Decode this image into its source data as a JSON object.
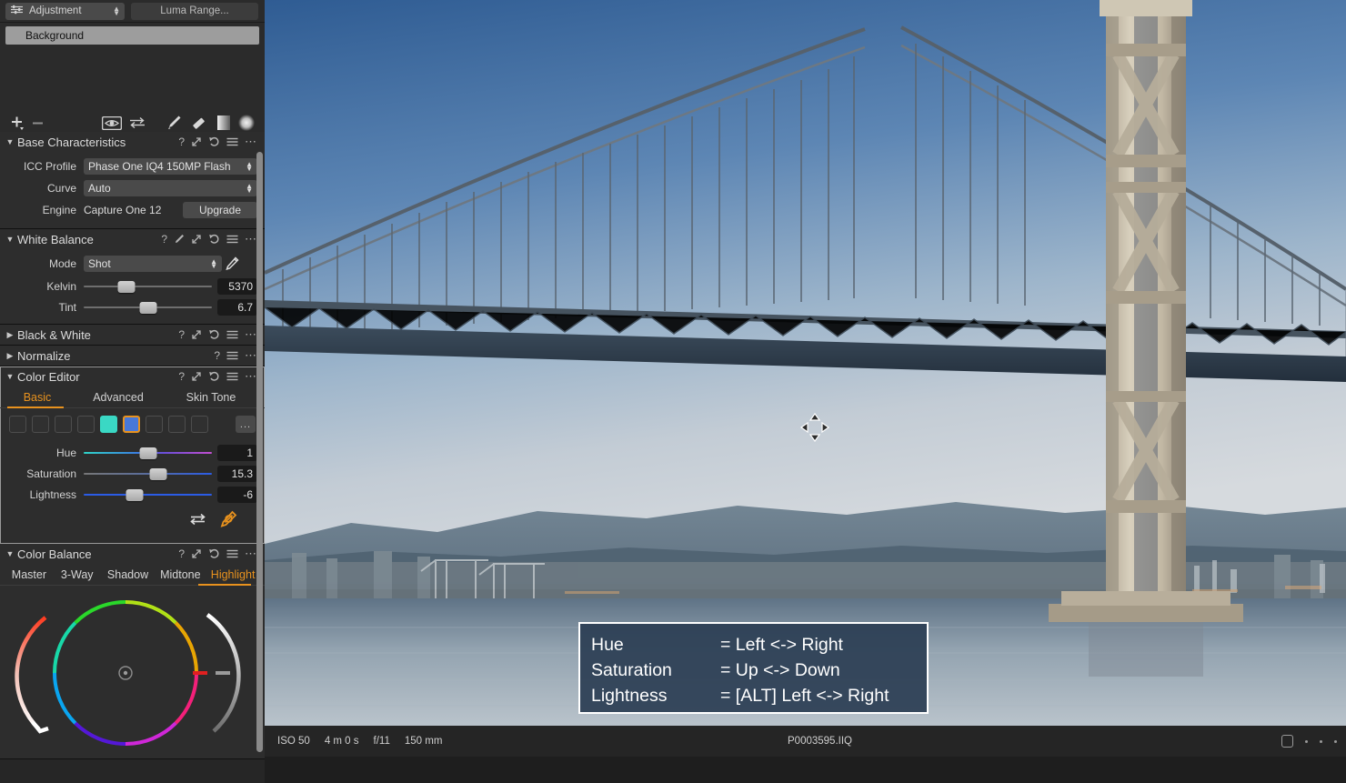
{
  "layer_bar": {
    "adjustment_label": "Adjustment",
    "adjustment_icon": "sliders-icon",
    "luma_range_label": "Luma Range...",
    "layers": [
      "Background"
    ],
    "tools": [
      "add-layer-icon",
      "remove-layer-icon",
      "eye-icon",
      "swap-icon",
      "brush-icon",
      "eraser-icon",
      "gradient-mask-icon",
      "radial-mask-icon"
    ]
  },
  "tools": {
    "base_characteristics": {
      "title": "Base Characteristics",
      "expanded": true,
      "icc_profile_label": "ICC Profile",
      "icc_profile_value": "Phase One IQ4 150MP Flash",
      "curve_label": "Curve",
      "curve_value": "Auto",
      "engine_label": "Engine",
      "engine_value": "Capture One 12",
      "upgrade_label": "Upgrade"
    },
    "white_balance": {
      "title": "White Balance",
      "expanded": true,
      "mode_label": "Mode",
      "mode_value": "Shot",
      "kelvin_label": "Kelvin",
      "kelvin_value": "5370",
      "kelvin_pct": 33,
      "tint_label": "Tint",
      "tint_value": "6.7",
      "tint_pct": 50
    },
    "black_and_white": {
      "title": "Black & White",
      "expanded": false
    },
    "normalize": {
      "title": "Normalize",
      "expanded": false
    },
    "color_editor": {
      "title": "Color Editor",
      "expanded": true,
      "tabs": [
        {
          "label": "Basic",
          "active": true
        },
        {
          "label": "Advanced",
          "active": false
        },
        {
          "label": "Skin Tone",
          "active": false
        }
      ],
      "swatches": [
        {
          "color": null,
          "selected": false
        },
        {
          "color": null,
          "selected": false
        },
        {
          "color": null,
          "selected": false
        },
        {
          "color": null,
          "selected": false
        },
        {
          "color": "#3ad8c4",
          "selected": false
        },
        {
          "color": "#4878d8",
          "selected": true
        },
        {
          "color": null,
          "selected": false
        },
        {
          "color": null,
          "selected": false
        },
        {
          "color": null,
          "selected": false
        }
      ],
      "more_label": "...",
      "hue_label": "Hue",
      "hue_value": "1",
      "hue_pct": 50,
      "saturation_label": "Saturation",
      "saturation_value": "15.3",
      "saturation_pct": 58,
      "lightness_label": "Lightness",
      "lightness_value": "-6",
      "lightness_pct": 40,
      "footer_icons": [
        "swap-arrows-icon",
        "color-picker-icon"
      ]
    },
    "color_balance": {
      "title": "Color Balance",
      "expanded": true,
      "tabs": [
        {
          "label": "Master",
          "active": false
        },
        {
          "label": "3-Way",
          "active": false
        },
        {
          "label": "Shadow",
          "active": false
        },
        {
          "label": "Midtone",
          "active": false
        },
        {
          "label": "Highlight",
          "active": true
        }
      ]
    }
  },
  "panel_head_icons": [
    "help-icon",
    "picker-icon",
    "expand-icon",
    "reset-icon",
    "menu-icon",
    "more-icon"
  ],
  "hint_overlay": {
    "rows": [
      {
        "key": "Hue",
        "value": "= Left <-> Right"
      },
      {
        "key": "Saturation",
        "value": "= Up <-> Down"
      },
      {
        "key": "Lightness",
        "value": "= [ALT] Left <-> Right"
      }
    ]
  },
  "status_bar": {
    "iso": "ISO 50",
    "shutter": "4 m 0 s",
    "aperture": "f/11",
    "focal": "150 mm",
    "filename": "P0003595.IIQ",
    "right_icons": [
      "proof-square-icon",
      "dot-icon",
      "dot-icon",
      "dot-icon"
    ]
  },
  "cursor": {
    "name": "move-cursor"
  },
  "colors": {
    "accent": "#e8921e",
    "panel_bg": "#2d2d2d",
    "panel_dark": "#262626",
    "hint_bg": "#2c3e54"
  }
}
